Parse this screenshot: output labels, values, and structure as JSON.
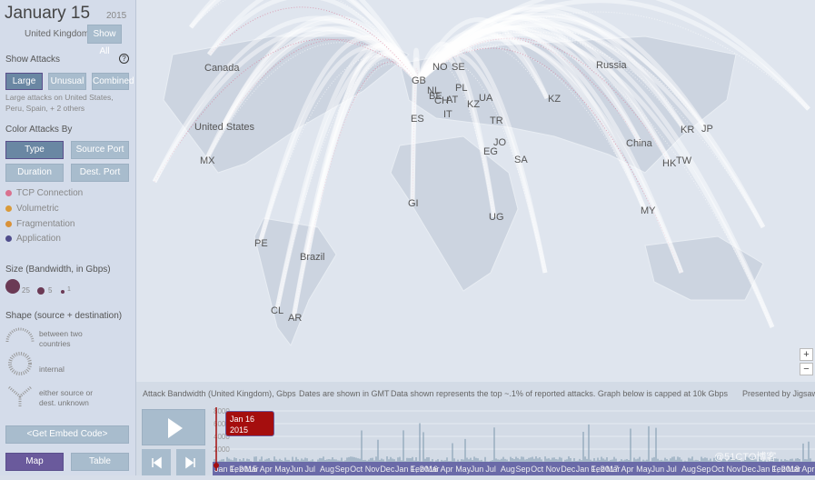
{
  "header": {
    "date": "January 15",
    "year": "2015",
    "country": "United Kingdom",
    "show_all": "Show All"
  },
  "show_attacks": {
    "title": "Show Attacks",
    "help": "?",
    "buttons": [
      "Large",
      "Unusual",
      "Combined"
    ],
    "active": "Large",
    "description": "Large attacks on United States, Peru, Spain, + 2 others"
  },
  "color_by": {
    "title": "Color Attacks By",
    "buttons": [
      "Type",
      "Source Port",
      "Duration",
      "Dest. Port"
    ],
    "active": "Type",
    "legend": [
      {
        "label": "TCP Connection",
        "color": "#d9718e"
      },
      {
        "label": "Volumetric",
        "color": "#d99a3a"
      },
      {
        "label": "Fragmentation",
        "color": "#d9923a"
      },
      {
        "label": "Application",
        "color": "#4f4d8c"
      }
    ]
  },
  "size": {
    "title": "Size (Bandwidth, in Gbps)",
    "values": [
      "25",
      "5",
      "1"
    ],
    "color": "#6b3a55"
  },
  "shape": {
    "title": "Shape (source + destination)",
    "items": [
      "between two countries",
      "internal",
      "either source or dest. unknown"
    ]
  },
  "embed": "<Get Embed Code>",
  "views": {
    "map": "Map",
    "table": "Table",
    "active": "Map"
  },
  "map": {
    "labels": [
      "Canada",
      "United States",
      "MX",
      "PE",
      "Brazil",
      "CL",
      "AR",
      "GI",
      "UG",
      "ES",
      "GB",
      "NO",
      "SE",
      "NL",
      "BE",
      "CH",
      "AT",
      "IT",
      "PL",
      "UA",
      "KZ",
      "TR",
      "JO",
      "EG",
      "SA",
      "KZ",
      "Russia",
      "China",
      "KR",
      "JP",
      "HK",
      "TW",
      "MY"
    ],
    "zoom_in": "+",
    "zoom_out": "−",
    "arc_color": "#ffffff",
    "highlight_color": "#d9718e"
  },
  "timeline": {
    "notes": [
      "Attack Bandwidth (United Kingdom), Gbps",
      "Dates are shown in GMT",
      "Data shown represents the top ~.1% of reported attacks. Graph below is capped at 10k Gbps",
      "Presented by Jigsaw"
    ],
    "y_ticks": [
      "8000",
      "6000",
      "4000",
      "2000"
    ],
    "tooltip": {
      "date": "Jan 16",
      "year": "2015"
    },
    "x_labels": [
      "Jan 1, 2015",
      "Feb",
      "Mar",
      "Apr",
      "May",
      "Jun",
      "Jul",
      "Aug",
      "Sep",
      "Oct",
      "Nov",
      "Dec",
      "Jan 1, 2016",
      "Feb",
      "Mar",
      "Apr",
      "May",
      "Jun",
      "Jul",
      "Aug",
      "Sep",
      "Oct",
      "Nov",
      "Dec",
      "Jan 1, 2017",
      "Feb",
      "Mar",
      "Apr",
      "May",
      "Jun",
      "Jul",
      "Aug",
      "Sep",
      "Oct",
      "Nov",
      "Dec",
      "Jan 1, 2018",
      "Feb",
      "Mar",
      "Apr"
    ],
    "watermark": "@51CTO博客"
  }
}
